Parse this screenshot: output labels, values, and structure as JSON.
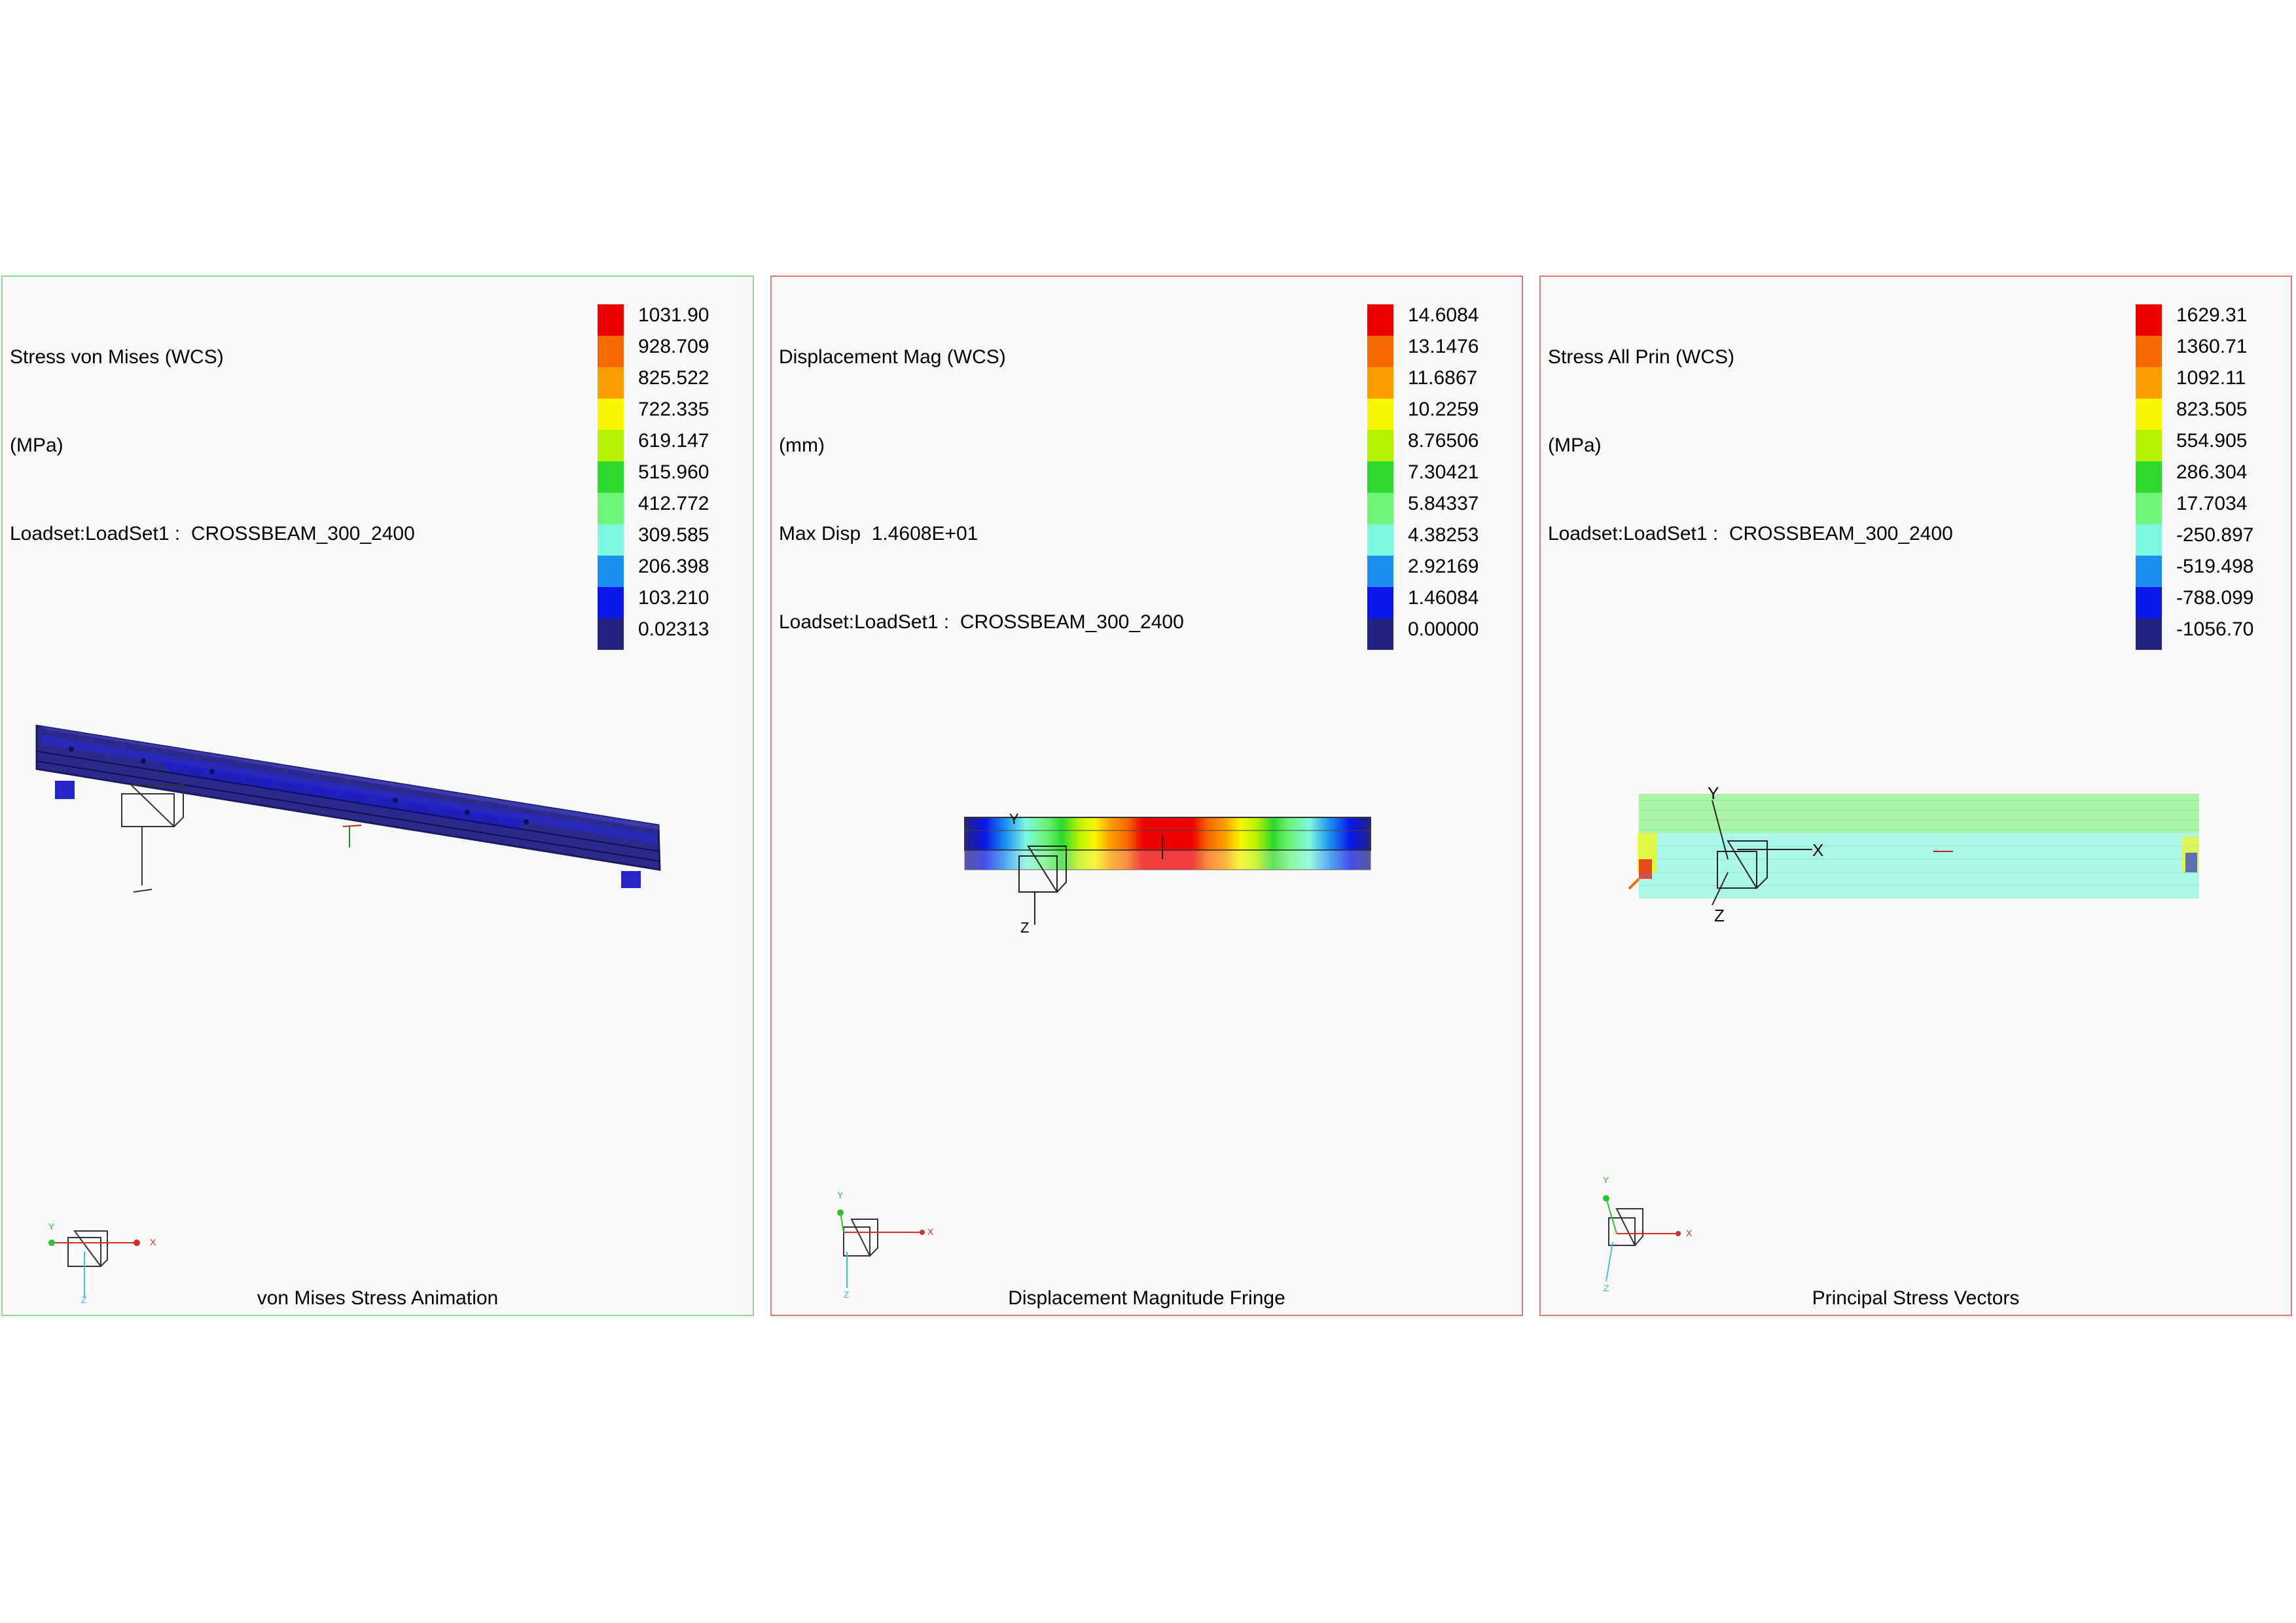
{
  "palette": [
    "#232382",
    "#0b16e8",
    "#1a8ff0",
    "#7cf7e0",
    "#6df579",
    "#2dd92d",
    "#b4f200",
    "#f7f700",
    "#fb9c00",
    "#f76a00",
    "#ee0000"
  ],
  "panels": [
    {
      "header": [
        "Stress von Mises (WCS)",
        "(MPa)",
        "Loadset:LoadSet1 :  CROSSBEAM_300_2400"
      ],
      "legend": [
        "1031.90",
        "928.709",
        "825.522",
        "722.335",
        "619.147",
        "515.960",
        "412.772",
        "309.585",
        "206.398",
        "103.210",
        "0.02313"
      ],
      "caption": "von Mises Stress Animation",
      "axis_labels": {
        "x": "X",
        "y": "Y",
        "z": "Z"
      }
    },
    {
      "header": [
        "Displacement Mag (WCS)",
        "(mm)",
        "Max Disp  1.4608E+01",
        "Loadset:LoadSet1 :  CROSSBEAM_300_2400"
      ],
      "legend": [
        "14.6084",
        "13.1476",
        "11.6867",
        "10.2259",
        "8.76506",
        "7.30421",
        "5.84337",
        "4.38253",
        "2.92169",
        "1.46084",
        "0.00000"
      ],
      "caption": "Displacement Magnitude Fringe",
      "axis_labels": {
        "x": "X",
        "y": "Y",
        "z": "Z"
      }
    },
    {
      "header": [
        "Stress All Prin (WCS)",
        "(MPa)",
        "Loadset:LoadSet1 :  CROSSBEAM_300_2400"
      ],
      "legend": [
        "1629.31",
        "1360.71",
        "1092.11",
        "823.505",
        "554.905",
        "286.304",
        "17.7034",
        "-250.897",
        "-519.498",
        "-788.099",
        "-1056.70"
      ],
      "caption": "Principal Stress Vectors",
      "axis_labels": {
        "x": "X",
        "y": "Y",
        "z": "Z"
      }
    }
  ]
}
